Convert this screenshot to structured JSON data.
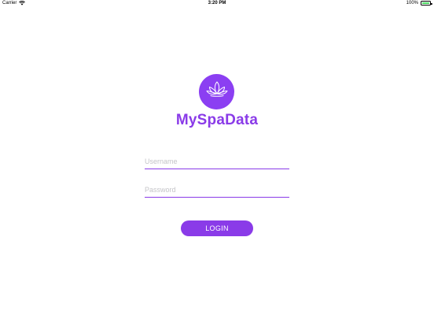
{
  "status_bar": {
    "carrier": "Carrier",
    "time": "3:20 PM",
    "battery": "100%"
  },
  "brand": {
    "logo_icon": "lotus-icon",
    "title": "MySpaData",
    "accent_color": "#8a3be8"
  },
  "login_form": {
    "username_placeholder": "Username",
    "username_value": "",
    "password_placeholder": "Password",
    "password_value": "",
    "login_label": "LOGIN"
  }
}
